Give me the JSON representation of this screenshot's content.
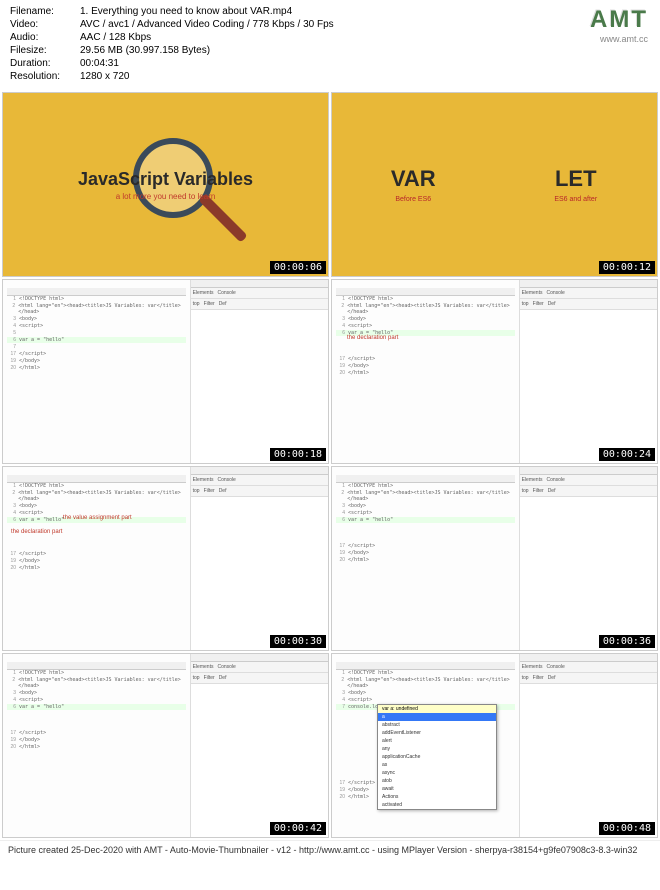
{
  "header": {
    "filename_label": "Filename:",
    "filename": "1. Everything you need to know about VAR.mp4",
    "video_label": "Video:",
    "video": "AVC / avc1 / Advanced Video Coding / 778 Kbps / 30 Fps",
    "audio_label": "Audio:",
    "audio": "AAC / 128 Kbps",
    "filesize_label": "Filesize:",
    "filesize": "29.56 MB (30.997.158 Bytes)",
    "duration_label": "Duration:",
    "duration": "00:04:31",
    "resolution_label": "Resolution:",
    "resolution": "1280 x 720"
  },
  "logo": {
    "text": "AMT",
    "url": "www.amt.cc"
  },
  "thumbs": {
    "t1": {
      "time": "00:00:06",
      "title": "JavaScript Variables",
      "sub": "a lot more you need to learn"
    },
    "t2": {
      "time": "00:00:12",
      "var_big": "VAR",
      "var_small": "Before ES6",
      "let_big": "LET",
      "let_small": "ES6 and after"
    },
    "t3": {
      "time": "00:00:18",
      "code_title": "JS Variables: var",
      "var_line": "var a = \"hello\""
    },
    "t4": {
      "time": "00:00:24",
      "code_title": "JS Variables: var",
      "var_line": "var a = \"hello\"",
      "annotation": "the declaration part"
    },
    "t5": {
      "time": "00:00:30",
      "code_title": "JS Variables: var",
      "var_line": "var a = \"hello\"",
      "ann1": "the declaration part",
      "ann2": "the value assignment part"
    },
    "t6": {
      "time": "00:00:36",
      "code_title": "JS Variables: var",
      "var_line": "var a = \"hello\""
    },
    "t7": {
      "time": "00:00:42",
      "code_title": "JS Variables: var",
      "var_line": "var a = \"hello\""
    },
    "t8": {
      "time": "00:00:48",
      "code_title": "JS Variables: var",
      "console_line": "console.log(a)",
      "tooltip": "var a: undefined",
      "autocomplete": [
        "a",
        "abstract",
        "addEventListener",
        "alert",
        "any",
        "applicationCache",
        "as",
        "async",
        "atob",
        "await",
        "Actions",
        "activated"
      ]
    }
  },
  "devtools": {
    "elements": "Elements",
    "console": "Console",
    "top": "top",
    "filter": "Filter",
    "def": "Def"
  },
  "code_common": {
    "doctype": "<!DOCTYPE html>",
    "html_open": "<html lang=\"en\"><head><title>",
    "title_close": "</title></head>",
    "body": "<body>",
    "script": "<script>",
    "script_close": "</script>",
    "body_close": "</body>",
    "html_close": "</html>"
  },
  "footer": "Picture created 25-Dec-2020 with AMT - Auto-Movie-Thumbnailer - v12 - http://www.amt.cc - using MPlayer Version - sherpya-r38154+g9fe07908c3-8.3-win32"
}
